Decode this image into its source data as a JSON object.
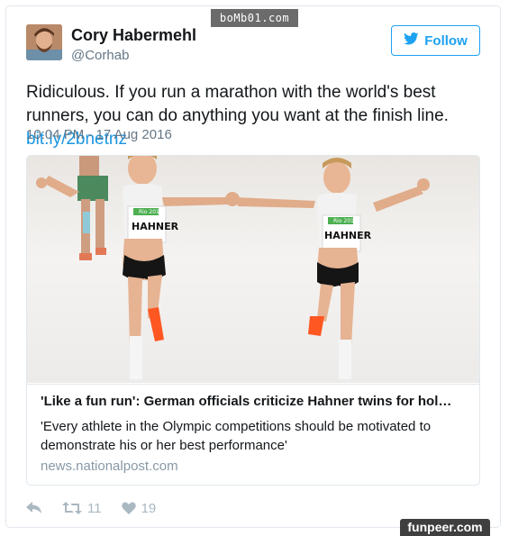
{
  "watermark_top": "boMb01.com",
  "watermark_bottom": "funpeer.com",
  "author": {
    "name": "Cory Habermehl",
    "handle": "@Corhab"
  },
  "follow_button": {
    "label": "Follow",
    "icon": "twitter-bird-icon"
  },
  "tweet": {
    "text": "Ridiculous. If you run a marathon with the world's best runners, you can do anything you want at the finish line.",
    "link": "bit.ly/2bnetnz",
    "timestamp": "10:04 PM - 17 Aug 2016"
  },
  "card": {
    "photo_bib_left": "HAHNER",
    "photo_bib_right": "HAHNER",
    "bib_badge": "Rio 2016",
    "title": "'Like a fun run': German officials criticize Hahner twins for hol…",
    "description": "'Every athlete in the Olympic competitions should be motivated to demonstrate his or her best performance'",
    "domain": "news.nationalpost.com"
  },
  "actions": {
    "reply_icon": "reply-icon",
    "retweet_icon": "retweet-icon",
    "retweet_count": "11",
    "like_icon": "heart-icon",
    "like_count": "19"
  },
  "colors": {
    "accent": "#1da1f2",
    "link": "#1b95e0",
    "muted": "#657786",
    "action": "#aab8c2"
  }
}
